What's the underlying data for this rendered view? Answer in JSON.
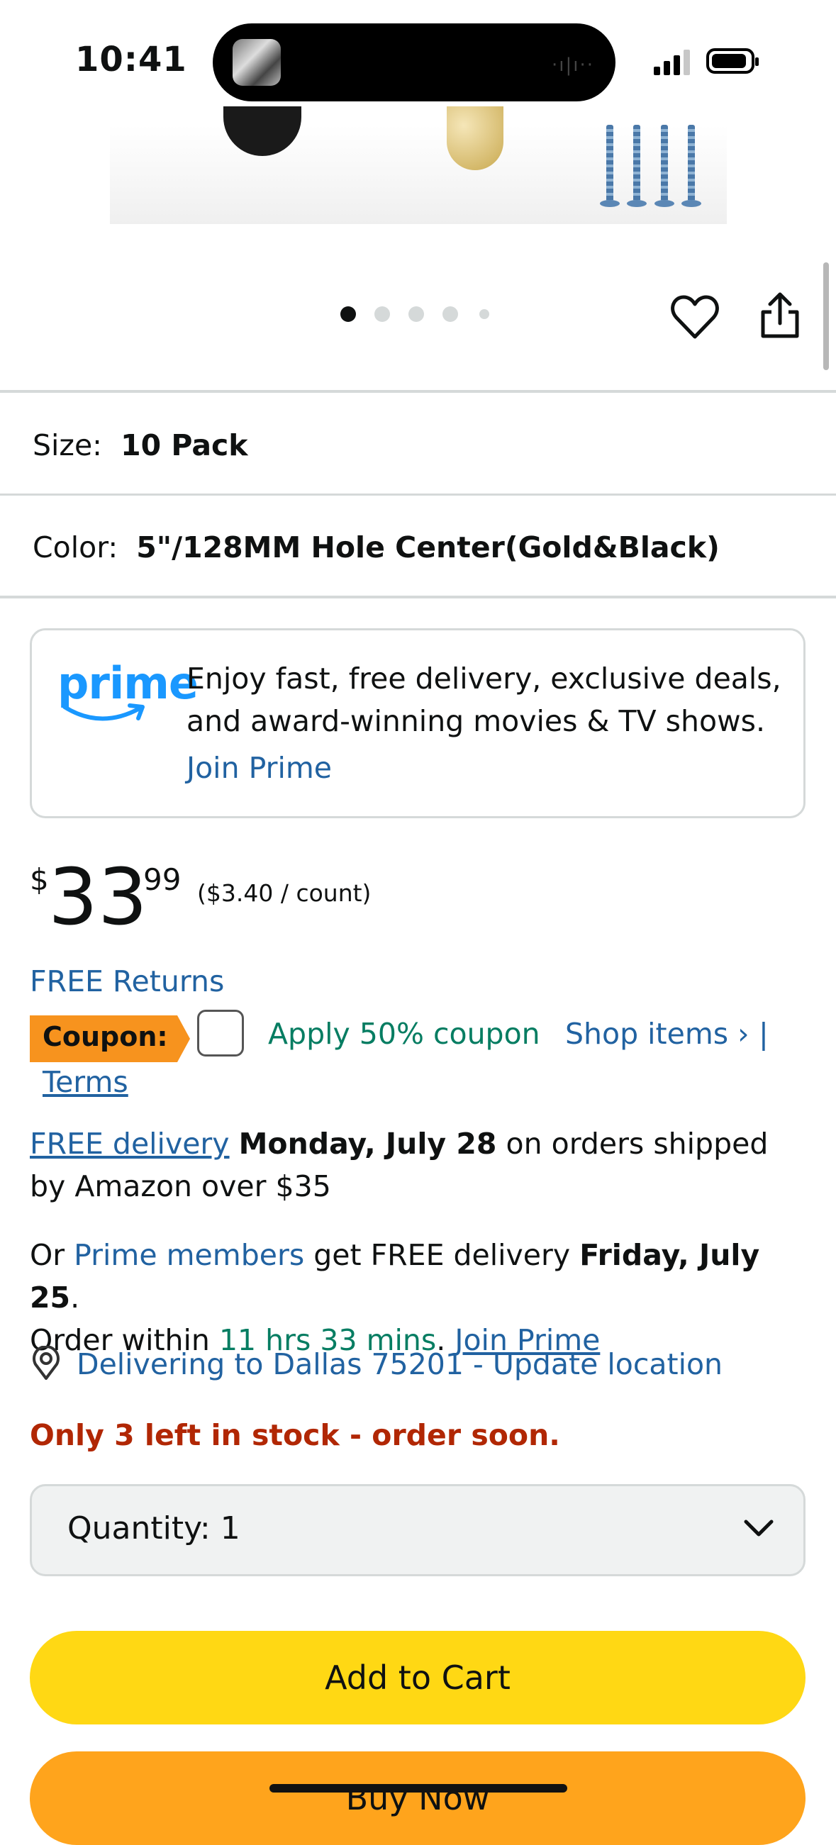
{
  "status_bar": {
    "time": "10:41"
  },
  "product": {
    "size_label": "Size:",
    "size_value": "10 Pack",
    "color_label": "Color:",
    "color_value": "5\"/128MM Hole Center(Gold&Black)"
  },
  "prime": {
    "logo": "prime",
    "text": "Enjoy fast, free delivery, exclusive deals, and award-winning movies & TV shows.",
    "join": "Join Prime"
  },
  "price": {
    "currency": "$",
    "whole": "33",
    "fraction": "99",
    "per_unit": "($3.40 / count)"
  },
  "returns": "FREE Returns",
  "coupon": {
    "badge": "Coupon:",
    "apply": "Apply 50% coupon",
    "shop": "Shop items ›",
    "separator": "|",
    "terms": "Terms"
  },
  "delivery": {
    "free_delivery_link": "FREE delivery",
    "date": "Monday, July 28",
    "rest": " on orders shipped by Amazon over $35",
    "or": "Or ",
    "prime_members": "Prime members",
    "get_free": " get FREE delivery ",
    "prime_date": "Friday, July 25",
    "period": ".",
    "order_within": "Order within ",
    "countdown": "11 hrs 33 mins",
    "join_prime": "Join Prime"
  },
  "location": "Delivering to Dallas 75201 - Update location",
  "stock": "Only 3 left in stock - order soon.",
  "quantity": "Quantity:  1",
  "buttons": {
    "add_to_cart": "Add to Cart",
    "buy_now": "Buy Now"
  },
  "carousel": {
    "total": 5,
    "active": 1
  }
}
